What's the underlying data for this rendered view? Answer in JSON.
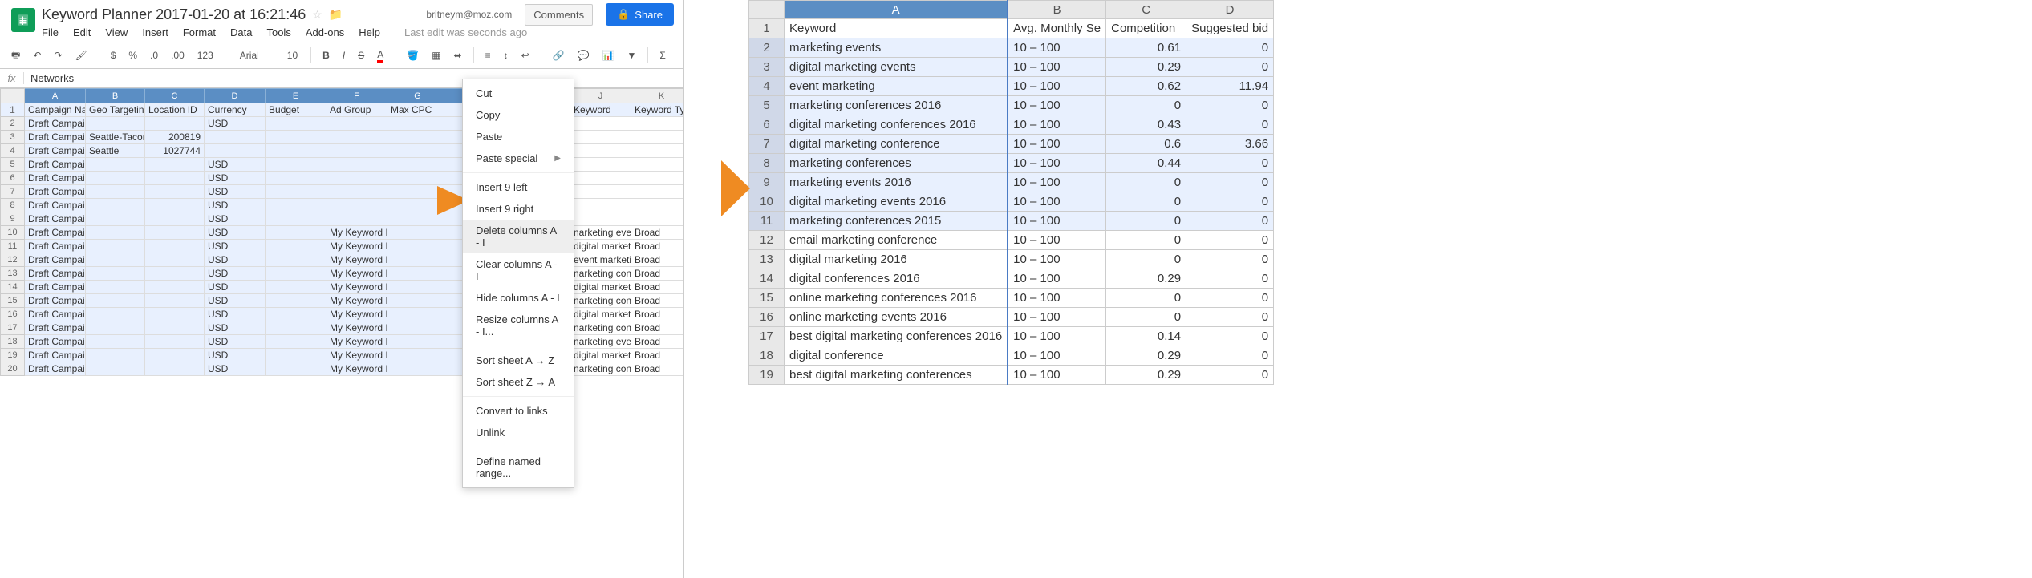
{
  "header": {
    "title": "Keyword Planner 2017-01-20 at 16:21:46",
    "email": "britneym@moz.com",
    "comments": "Comments",
    "share": "Share",
    "lastedit": "Last edit was seconds ago",
    "menus": [
      "File",
      "Edit",
      "View",
      "Insert",
      "Format",
      "Data",
      "Tools",
      "Add-ons",
      "Help"
    ]
  },
  "toolbar": {
    "font": "Arial",
    "size": "10",
    "numfmt": "123"
  },
  "fx": {
    "label": "fx",
    "value": "Networks"
  },
  "cols": [
    "A",
    "B",
    "C",
    "D",
    "E",
    "F",
    "G",
    "",
    "",
    "J",
    "K"
  ],
  "headers": [
    "Campaign Name",
    "Geo Targeting",
    "Location ID",
    "Currency",
    "Budget",
    "Ad Group",
    "Max CPC",
    "",
    "",
    "Keyword",
    "Keyword Ty"
  ],
  "rows": [
    [
      "Draft Campaign",
      "",
      "",
      "USD",
      "",
      "",
      "",
      "",
      "",
      "",
      ""
    ],
    [
      "Draft Campaign",
      "Seattle-Tacoma V",
      "200819",
      "",
      "",
      "",
      "",
      "",
      "",
      "",
      ""
    ],
    [
      "Draft Campaign",
      "Seattle",
      "1027744",
      "",
      "",
      "",
      "",
      "",
      "",
      "",
      ""
    ],
    [
      "Draft Campaign",
      "",
      "",
      "USD",
      "",
      "",
      "",
      "",
      "",
      "",
      ""
    ],
    [
      "Draft Campaign",
      "",
      "",
      "USD",
      "",
      "",
      "",
      "",
      "",
      "",
      ""
    ],
    [
      "Draft Campaign",
      "",
      "",
      "USD",
      "",
      "",
      "",
      "",
      "",
      "",
      ""
    ],
    [
      "Draft Campaign",
      "",
      "",
      "USD",
      "",
      "",
      "",
      "",
      "",
      "",
      ""
    ],
    [
      "Draft Campaign",
      "",
      "",
      "USD",
      "",
      "",
      "",
      "",
      "",
      "",
      ""
    ],
    [
      "Draft Campaign",
      "",
      "",
      "USD",
      "",
      "My Keyword Ideas",
      "",
      "",
      "",
      "narketing events",
      "Broad"
    ],
    [
      "Draft Campaign",
      "",
      "",
      "USD",
      "",
      "My Keyword Ideas",
      "",
      "",
      "",
      "digital marketing",
      "Broad"
    ],
    [
      "Draft Campaign",
      "",
      "",
      "USD",
      "",
      "My Keyword Ideas",
      "",
      "",
      "",
      "event marketing",
      "Broad"
    ],
    [
      "Draft Campaign",
      "",
      "",
      "USD",
      "",
      "My Keyword Ideas",
      "",
      "",
      "",
      "narketing confer",
      "Broad"
    ],
    [
      "Draft Campaign",
      "",
      "",
      "USD",
      "",
      "My Keyword Ideas",
      "",
      "",
      "",
      "digital marketing",
      "Broad"
    ],
    [
      "Draft Campaign",
      "",
      "",
      "USD",
      "",
      "My Keyword Ideas",
      "",
      "",
      "",
      "narketing confer",
      "Broad"
    ],
    [
      "Draft Campaign",
      "",
      "",
      "USD",
      "",
      "My Keyword Ideas",
      "",
      "",
      "",
      "digital marketing",
      "Broad"
    ],
    [
      "Draft Campaign",
      "",
      "",
      "USD",
      "",
      "My Keyword Ideas",
      "",
      "",
      "",
      "narketing confer",
      "Broad"
    ],
    [
      "Draft Campaign",
      "",
      "",
      "USD",
      "",
      "My Keyword Ideas",
      "",
      "",
      "",
      "narketing events",
      "Broad"
    ],
    [
      "Draft Campaign",
      "",
      "",
      "USD",
      "",
      "My Keyword Ideas",
      "",
      "",
      "",
      "digital marketing",
      "Broad"
    ],
    [
      "Draft Campaign",
      "",
      "",
      "USD",
      "",
      "My Keyword Ideas",
      "",
      "",
      "",
      "narketing confer",
      "Broad"
    ]
  ],
  "context_menu": {
    "items": [
      {
        "label": "Cut",
        "sep": false
      },
      {
        "label": "Copy",
        "sep": false
      },
      {
        "label": "Paste",
        "sep": false
      },
      {
        "label": "Paste special",
        "sep": false,
        "arrow": true
      },
      {
        "sep": true
      },
      {
        "label": "Insert 9 left",
        "sep": false
      },
      {
        "label": "Insert 9 right",
        "sep": false
      },
      {
        "label": "Delete columns A - I",
        "sep": false,
        "hover": true
      },
      {
        "label": "Clear columns A - I",
        "sep": false
      },
      {
        "label": "Hide columns A - I",
        "sep": false
      },
      {
        "label": "Resize columns A - I...",
        "sep": false
      },
      {
        "sep": true
      },
      {
        "label": "Sort sheet A → Z",
        "sep": false
      },
      {
        "label": "Sort sheet Z → A",
        "sep": false
      },
      {
        "sep": true
      },
      {
        "label": "Convert to links",
        "sep": false
      },
      {
        "label": "Unlink",
        "sep": false
      },
      {
        "sep": true
      },
      {
        "label": "Define named range...",
        "sep": false
      }
    ]
  },
  "right": {
    "cols": [
      "A",
      "B",
      "C",
      "D"
    ],
    "headers": [
      "Keyword",
      "Avg. Monthly Se",
      "Competition",
      "Suggested bid"
    ],
    "rows": [
      {
        "k": "marketing events",
        "s": "10 – 100",
        "c": "0.61",
        "b": "0",
        "sel": true
      },
      {
        "k": "digital marketing events",
        "s": "10 – 100",
        "c": "0.29",
        "b": "0",
        "sel": true
      },
      {
        "k": "event marketing",
        "s": "10 – 100",
        "c": "0.62",
        "b": "11.94",
        "sel": true
      },
      {
        "k": "marketing conferences 2016",
        "s": "10 – 100",
        "c": "0",
        "b": "0",
        "sel": true
      },
      {
        "k": "digital marketing conferences 2016",
        "s": "10 – 100",
        "c": "0.43",
        "b": "0",
        "sel": true
      },
      {
        "k": "digital marketing conference",
        "s": "10 – 100",
        "c": "0.6",
        "b": "3.66",
        "sel": true
      },
      {
        "k": "marketing conferences",
        "s": "10 – 100",
        "c": "0.44",
        "b": "0",
        "sel": true
      },
      {
        "k": "marketing events 2016",
        "s": "10 – 100",
        "c": "0",
        "b": "0",
        "sel": true
      },
      {
        "k": "digital marketing events 2016",
        "s": "10 – 100",
        "c": "0",
        "b": "0",
        "sel": true
      },
      {
        "k": "marketing conferences 2015",
        "s": "10 – 100",
        "c": "0",
        "b": "0",
        "sel": true
      },
      {
        "k": "email marketing conference",
        "s": "10 – 100",
        "c": "0",
        "b": "0",
        "sel": false
      },
      {
        "k": "digital marketing 2016",
        "s": "10 – 100",
        "c": "0",
        "b": "0",
        "sel": false
      },
      {
        "k": "digital conferences 2016",
        "s": "10 – 100",
        "c": "0.29",
        "b": "0",
        "sel": false
      },
      {
        "k": "online marketing conferences 2016",
        "s": "10 – 100",
        "c": "0",
        "b": "0",
        "sel": false
      },
      {
        "k": "online marketing events 2016",
        "s": "10 – 100",
        "c": "0",
        "b": "0",
        "sel": false
      },
      {
        "k": "best digital marketing conferences 2016",
        "s": "10 – 100",
        "c": "0.14",
        "b": "0",
        "sel": false
      },
      {
        "k": "digital conference",
        "s": "10 – 100",
        "c": "0.29",
        "b": "0",
        "sel": false
      },
      {
        "k": "best digital marketing conferences",
        "s": "10 – 100",
        "c": "0.29",
        "b": "0",
        "sel": false
      }
    ]
  }
}
